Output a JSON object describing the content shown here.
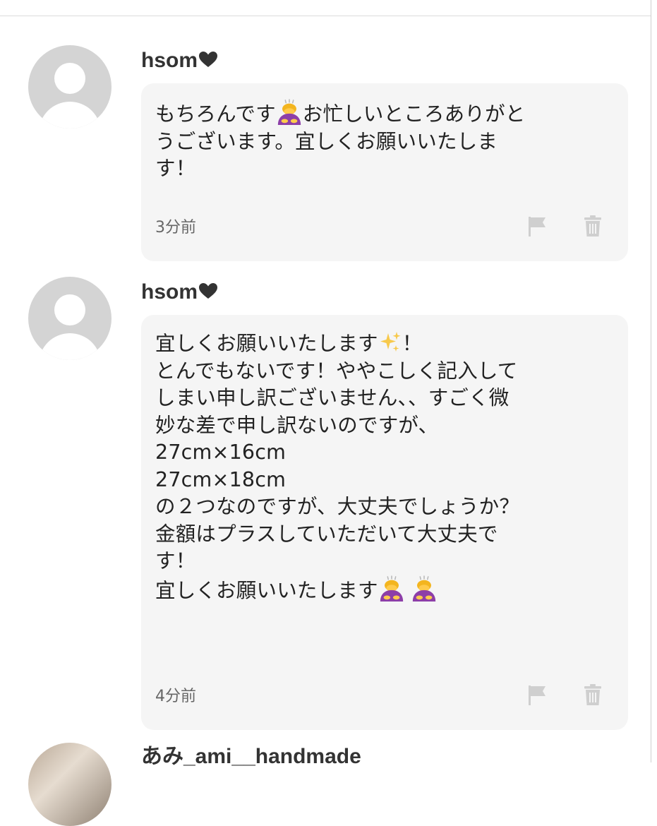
{
  "comments": [
    {
      "username": "hsom",
      "name_suffix_icon": "black-heart-icon",
      "lines": [
        {
          "segments": [
            {
              "text": "もちろんです"
            },
            {
              "emoji": "person-bowing-emoji"
            },
            {
              "text": "お忙しいところありがと"
            }
          ]
        },
        {
          "segments": [
            {
              "text": "うございます。宜しくお願いいたしま"
            }
          ]
        },
        {
          "segments": [
            {
              "text": "す！"
            }
          ]
        }
      ],
      "time": "3分前",
      "actions": [
        "flag-icon",
        "trash-icon"
      ]
    },
    {
      "username": "hsom",
      "name_suffix_icon": "black-heart-icon",
      "lines": [
        {
          "segments": [
            {
              "text": "宜しくお願いいたします"
            },
            {
              "emoji": "sparkles-emoji"
            },
            {
              "text": "！"
            }
          ]
        },
        {
          "segments": [
            {
              "text": "とんでもないです！ややこしく記入して"
            }
          ]
        },
        {
          "segments": [
            {
              "text": "しまい申し訳ございません、、すごく微"
            }
          ]
        },
        {
          "segments": [
            {
              "text": "妙な差で申し訳ないのですが、"
            }
          ]
        },
        {
          "segments": [
            {
              "text": "27cm×16cm"
            }
          ]
        },
        {
          "segments": [
            {
              "text": "27cm×18cm"
            }
          ]
        },
        {
          "segments": [
            {
              "text": "の２つなのですが、大丈夫でしょうか？"
            }
          ]
        },
        {
          "segments": [
            {
              "text": "金額はプラスしていただいて大丈夫で"
            }
          ]
        },
        {
          "segments": [
            {
              "text": "す！"
            }
          ]
        },
        {
          "segments": [
            {
              "text": "宜しくお願いいたします"
            },
            {
              "emoji": "person-bowing-emoji"
            },
            {
              "emoji": "person-bowing-emoji"
            }
          ]
        }
      ],
      "time": "4分前",
      "actions": [
        "flag-icon",
        "trash-icon"
      ]
    }
  ],
  "next_comment": {
    "username": "あみ_ami__handmade"
  },
  "colors": {
    "bubble_background": "#f5f5f5",
    "avatar_placeholder": "#d4d4d4",
    "icon_gray": "#cfcfcf",
    "text": "#222222",
    "time_text": "#666666"
  }
}
